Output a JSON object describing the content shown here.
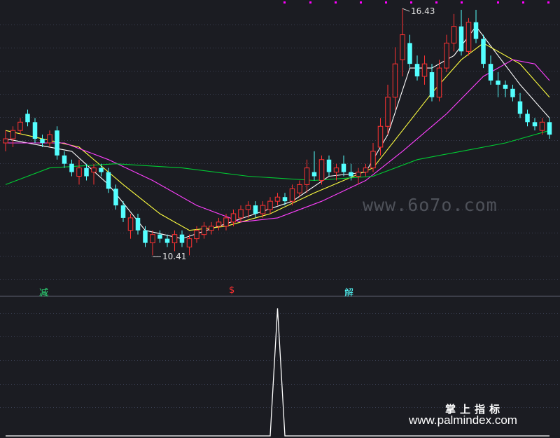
{
  "chart_data": [
    {
      "type": "candlestick",
      "panel": "main",
      "price_range": [
        9.9,
        16.5
      ],
      "high_label": "16.43",
      "low_label": "10.41",
      "candles": [
        [
          13.2,
          13.5,
          13.0,
          13.3
        ],
        [
          13.3,
          13.6,
          13.1,
          13.5
        ],
        [
          13.5,
          13.8,
          13.4,
          13.7
        ],
        [
          13.9,
          14.0,
          13.6,
          13.7
        ],
        [
          13.7,
          13.8,
          13.2,
          13.3
        ],
        [
          13.3,
          13.4,
          13.1,
          13.2
        ],
        [
          13.2,
          13.5,
          13.1,
          13.4
        ],
        [
          13.5,
          13.6,
          12.8,
          12.9
        ],
        [
          12.9,
          13.0,
          12.6,
          12.7
        ],
        [
          12.7,
          12.8,
          12.4,
          12.5
        ],
        [
          12.4,
          12.8,
          12.2,
          12.6
        ],
        [
          12.6,
          12.7,
          12.3,
          12.4
        ],
        [
          12.5,
          12.7,
          12.2,
          12.6
        ],
        [
          12.6,
          12.7,
          12.4,
          12.5
        ],
        [
          12.5,
          12.6,
          12.0,
          12.1
        ],
        [
          12.1,
          12.2,
          11.6,
          11.7
        ],
        [
          11.7,
          11.8,
          11.3,
          11.4
        ],
        [
          11.1,
          11.5,
          10.9,
          11.4
        ],
        [
          11.4,
          11.5,
          11.0,
          11.1
        ],
        [
          11.1,
          11.2,
          10.7,
          10.8
        ],
        [
          10.8,
          11.1,
          10.5,
          11.0
        ],
        [
          11.0,
          11.1,
          10.8,
          10.9
        ],
        [
          10.9,
          11.0,
          10.7,
          10.8
        ],
        [
          10.8,
          11.1,
          10.6,
          11.0
        ],
        [
          11.0,
          11.1,
          10.7,
          10.8
        ],
        [
          10.7,
          11.0,
          10.5,
          10.9
        ],
        [
          10.9,
          11.2,
          10.8,
          11.1
        ],
        [
          11.0,
          11.3,
          10.9,
          11.2
        ],
        [
          11.1,
          11.3,
          11.0,
          11.2
        ],
        [
          11.2,
          11.4,
          11.1,
          11.3
        ],
        [
          11.2,
          11.5,
          11.1,
          11.4
        ],
        [
          11.3,
          11.6,
          11.2,
          11.5
        ],
        [
          11.4,
          11.7,
          11.3,
          11.6
        ],
        [
          11.6,
          11.8,
          11.4,
          11.7
        ],
        [
          11.7,
          11.8,
          11.4,
          11.5
        ],
        [
          11.5,
          11.8,
          11.4,
          11.7
        ],
        [
          11.6,
          11.9,
          11.5,
          11.8
        ],
        [
          11.8,
          12.0,
          11.7,
          11.9
        ],
        [
          11.9,
          12.0,
          11.7,
          11.8
        ],
        [
          11.8,
          12.2,
          11.7,
          12.1
        ],
        [
          12.0,
          12.3,
          11.9,
          12.2
        ],
        [
          12.2,
          12.8,
          12.0,
          12.6
        ],
        [
          12.5,
          13.0,
          12.3,
          12.4
        ],
        [
          12.3,
          12.9,
          12.2,
          12.8
        ],
        [
          12.8,
          12.9,
          12.4,
          12.5
        ],
        [
          12.5,
          12.7,
          12.3,
          12.6
        ],
        [
          12.7,
          12.9,
          12.4,
          12.5
        ],
        [
          12.5,
          12.7,
          12.3,
          12.4
        ],
        [
          12.4,
          12.6,
          12.2,
          12.5
        ],
        [
          12.5,
          12.7,
          12.4,
          12.6
        ],
        [
          12.6,
          13.2,
          12.5,
          13.0
        ],
        [
          13.1,
          13.8,
          12.9,
          13.6
        ],
        [
          13.6,
          14.6,
          13.4,
          14.3
        ],
        [
          14.3,
          15.5,
          14.0,
          15.1
        ],
        [
          15.2,
          16.43,
          14.8,
          15.8
        ],
        [
          15.6,
          15.8,
          15.0,
          15.1
        ],
        [
          15.1,
          15.3,
          14.7,
          14.8
        ],
        [
          14.8,
          15.3,
          14.6,
          15.1
        ],
        [
          14.9,
          15.1,
          14.2,
          14.3
        ],
        [
          14.3,
          15.2,
          14.2,
          15.0
        ],
        [
          15.0,
          15.8,
          14.9,
          15.6
        ],
        [
          15.6,
          16.3,
          15.4,
          16.0
        ],
        [
          16.0,
          16.4,
          15.3,
          15.4
        ],
        [
          15.4,
          16.2,
          15.3,
          16.1
        ],
        [
          16.1,
          16.4,
          15.6,
          15.7
        ],
        [
          15.7,
          15.8,
          15.0,
          15.1
        ],
        [
          15.1,
          15.3,
          14.6,
          14.7
        ],
        [
          14.7,
          14.9,
          14.3,
          14.6
        ],
        [
          14.6,
          14.7,
          14.3,
          14.5
        ],
        [
          14.5,
          14.6,
          14.2,
          14.3
        ],
        [
          14.2,
          14.4,
          13.8,
          13.9
        ],
        [
          13.9,
          14.0,
          13.6,
          13.7
        ],
        [
          13.7,
          13.8,
          13.5,
          13.6
        ],
        [
          13.5,
          13.8,
          13.4,
          13.7
        ],
        [
          13.7,
          13.8,
          13.3,
          13.4
        ]
      ],
      "moving_averages": [
        {
          "color": "#ffffff",
          "points": [
            [
              0,
              13.3
            ],
            [
              9,
              13.0
            ],
            [
              14,
              12.2
            ],
            [
              19,
              11.1
            ],
            [
              24,
              10.9
            ],
            [
              29,
              11.2
            ],
            [
              34,
              11.5
            ],
            [
              39,
              11.8
            ],
            [
              44,
              12.4
            ],
            [
              49,
              12.5
            ],
            [
              52,
              13.4
            ],
            [
              55,
              15.0
            ],
            [
              58,
              15.0
            ],
            [
              61,
              15.3
            ],
            [
              64,
              16.0
            ],
            [
              67,
              15.3
            ],
            [
              70,
              14.6
            ],
            [
              74,
              13.8
            ]
          ]
        },
        {
          "color": "#ffff40",
          "points": [
            [
              0,
              13.5
            ],
            [
              10,
              13.1
            ],
            [
              16,
              12.2
            ],
            [
              21,
              11.5
            ],
            [
              25,
              11.1
            ],
            [
              30,
              11.2
            ],
            [
              36,
              11.5
            ],
            [
              42,
              12.0
            ],
            [
              46,
              12.3
            ],
            [
              50,
              12.6
            ],
            [
              54,
              13.5
            ],
            [
              58,
              14.4
            ],
            [
              62,
              15.2
            ],
            [
              65,
              15.6
            ],
            [
              70,
              15.1
            ],
            [
              74,
              14.3
            ]
          ]
        },
        {
          "color": "#ff40ff",
          "points": [
            [
              0,
              13.2
            ],
            [
              8,
              13.2
            ],
            [
              14,
              12.8
            ],
            [
              20,
              12.3
            ],
            [
              26,
              11.7
            ],
            [
              32,
              11.3
            ],
            [
              37,
              11.4
            ],
            [
              43,
              11.8
            ],
            [
              49,
              12.3
            ],
            [
              54,
              13.0
            ],
            [
              60,
              13.9
            ],
            [
              65,
              14.8
            ],
            [
              69,
              15.2
            ],
            [
              72,
              15.1
            ],
            [
              74,
              14.7
            ]
          ]
        },
        {
          "color": "#00cc33",
          "points": [
            [
              0,
              12.2
            ],
            [
              6,
              12.6
            ],
            [
              15,
              12.7
            ],
            [
              24,
              12.6
            ],
            [
              33,
              12.4
            ],
            [
              42,
              12.3
            ],
            [
              50,
              12.4
            ],
            [
              56,
              12.8
            ],
            [
              62,
              13.0
            ],
            [
              68,
              13.2
            ],
            [
              74,
              13.5
            ]
          ]
        }
      ]
    },
    {
      "type": "line",
      "panel": "indicator",
      "x": [
        0,
        36,
        37,
        38,
        74
      ],
      "y": [
        0,
        0,
        1,
        0,
        0
      ]
    }
  ],
  "annotations": {
    "signal_green": "减",
    "signal_red": "$",
    "signal_cyan": "解"
  },
  "watermarks": {
    "site1": "www.6o7o.com",
    "cn_label": "掌上指标",
    "site2": "www.palmindex.com"
  },
  "colors": {
    "up": "#ff3232",
    "down": "#54ffff",
    "background": "#1b1c22",
    "grid": "#3a3f52",
    "marker": "#ff00ff"
  }
}
